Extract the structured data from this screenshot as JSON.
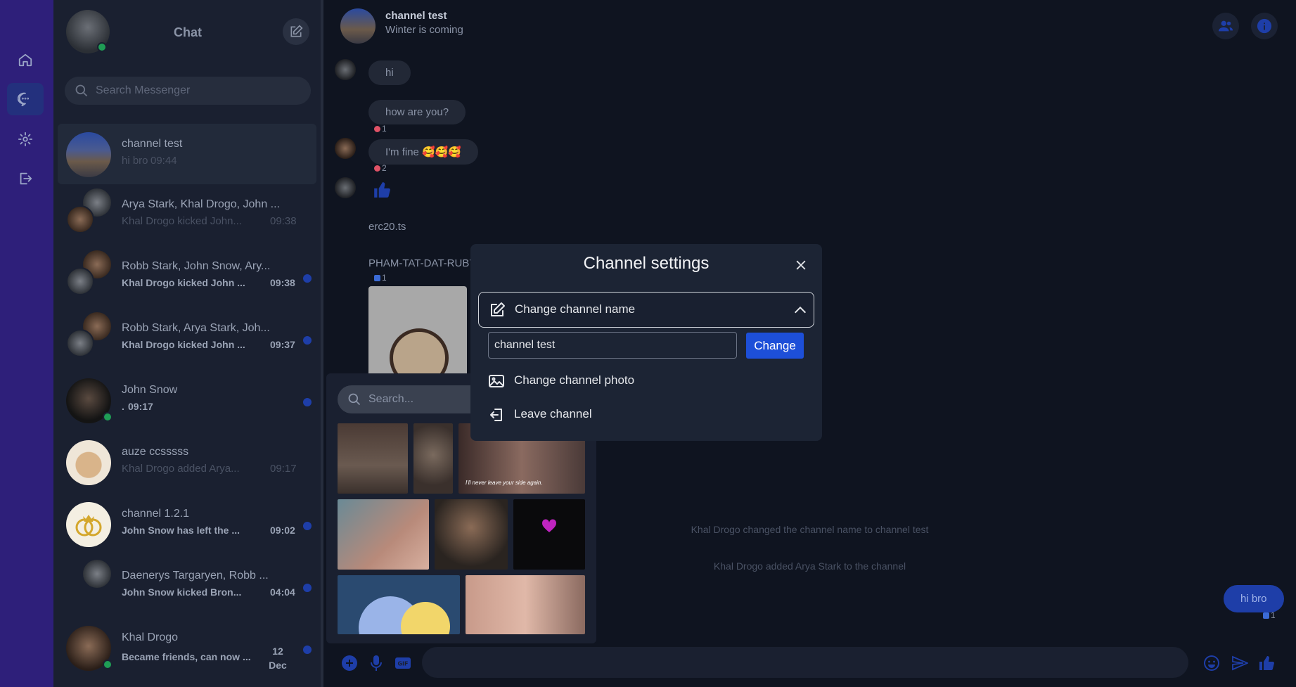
{
  "nav": {
    "icons": [
      "home-icon",
      "chat-icon",
      "settings-icon",
      "logout-icon"
    ]
  },
  "panel": {
    "title": "Chat",
    "search_placeholder": "Search Messenger",
    "conversations": [
      {
        "name": "channel test",
        "preview": "hi bro",
        "time": "09:44",
        "unread": false,
        "bold": false
      },
      {
        "name": "Arya Stark, Khal Drogo, John ...",
        "preview": "Khal Drogo kicked John...",
        "time": "09:38",
        "unread": false,
        "bold": false
      },
      {
        "name": "Robb Stark, John Snow, Ary...",
        "preview": "Khal Drogo kicked John ...",
        "time": "09:38",
        "unread": true,
        "bold": true
      },
      {
        "name": "Robb Stark, Arya Stark, Joh...",
        "preview": "Khal Drogo kicked John ...",
        "time": "09:37",
        "unread": true,
        "bold": true
      },
      {
        "name": "John Snow",
        "preview": ".",
        "time": "09:17",
        "unread": true,
        "bold": true
      },
      {
        "name": "auze ccsssss",
        "preview": "Khal Drogo added Arya...",
        "time": "09:17",
        "unread": false,
        "bold": false
      },
      {
        "name": "channel 1.2.1",
        "preview": "John Snow has left the ...",
        "time": "09:02",
        "unread": true,
        "bold": true
      },
      {
        "name": "Daenerys Targaryen, Robb ...",
        "preview": "John Snow kicked Bron...",
        "time": "04:04",
        "unread": true,
        "bold": true
      },
      {
        "name": "Khal Drogo",
        "preview": "Became friends, can now ...",
        "time": "12 Dec",
        "unread": true,
        "bold": true
      }
    ]
  },
  "header": {
    "name": "channel test",
    "subtitle": "Winter is coming"
  },
  "messages": {
    "m1": "hi",
    "m2": "how are you?",
    "m2_react": "1",
    "m3": "I'm fine 🥰🥰🥰",
    "m3_react": "2",
    "file1": "erc20.ts",
    "file2": "PHAM-TAT-DAT-RUBY",
    "file2_react": "1",
    "sys1": "Khal Drogo changed the channel name to channel test",
    "sys2": "Khal Drogo added Arya Stark to the channel",
    "mine": "hi bro",
    "mine_react": "1"
  },
  "gif_picker": {
    "search_placeholder": "Search...",
    "gif_caption": "I'll never leave your side again."
  },
  "modal": {
    "title": "Channel settings",
    "change_name_label": "Change channel name",
    "name_value": "channel test",
    "change_button": "Change",
    "change_photo_label": "Change channel photo",
    "leave_label": "Leave channel"
  },
  "colors": {
    "accent": "#1e3ea8",
    "rail": "#2e1f7a",
    "online": "#1f9d55"
  }
}
